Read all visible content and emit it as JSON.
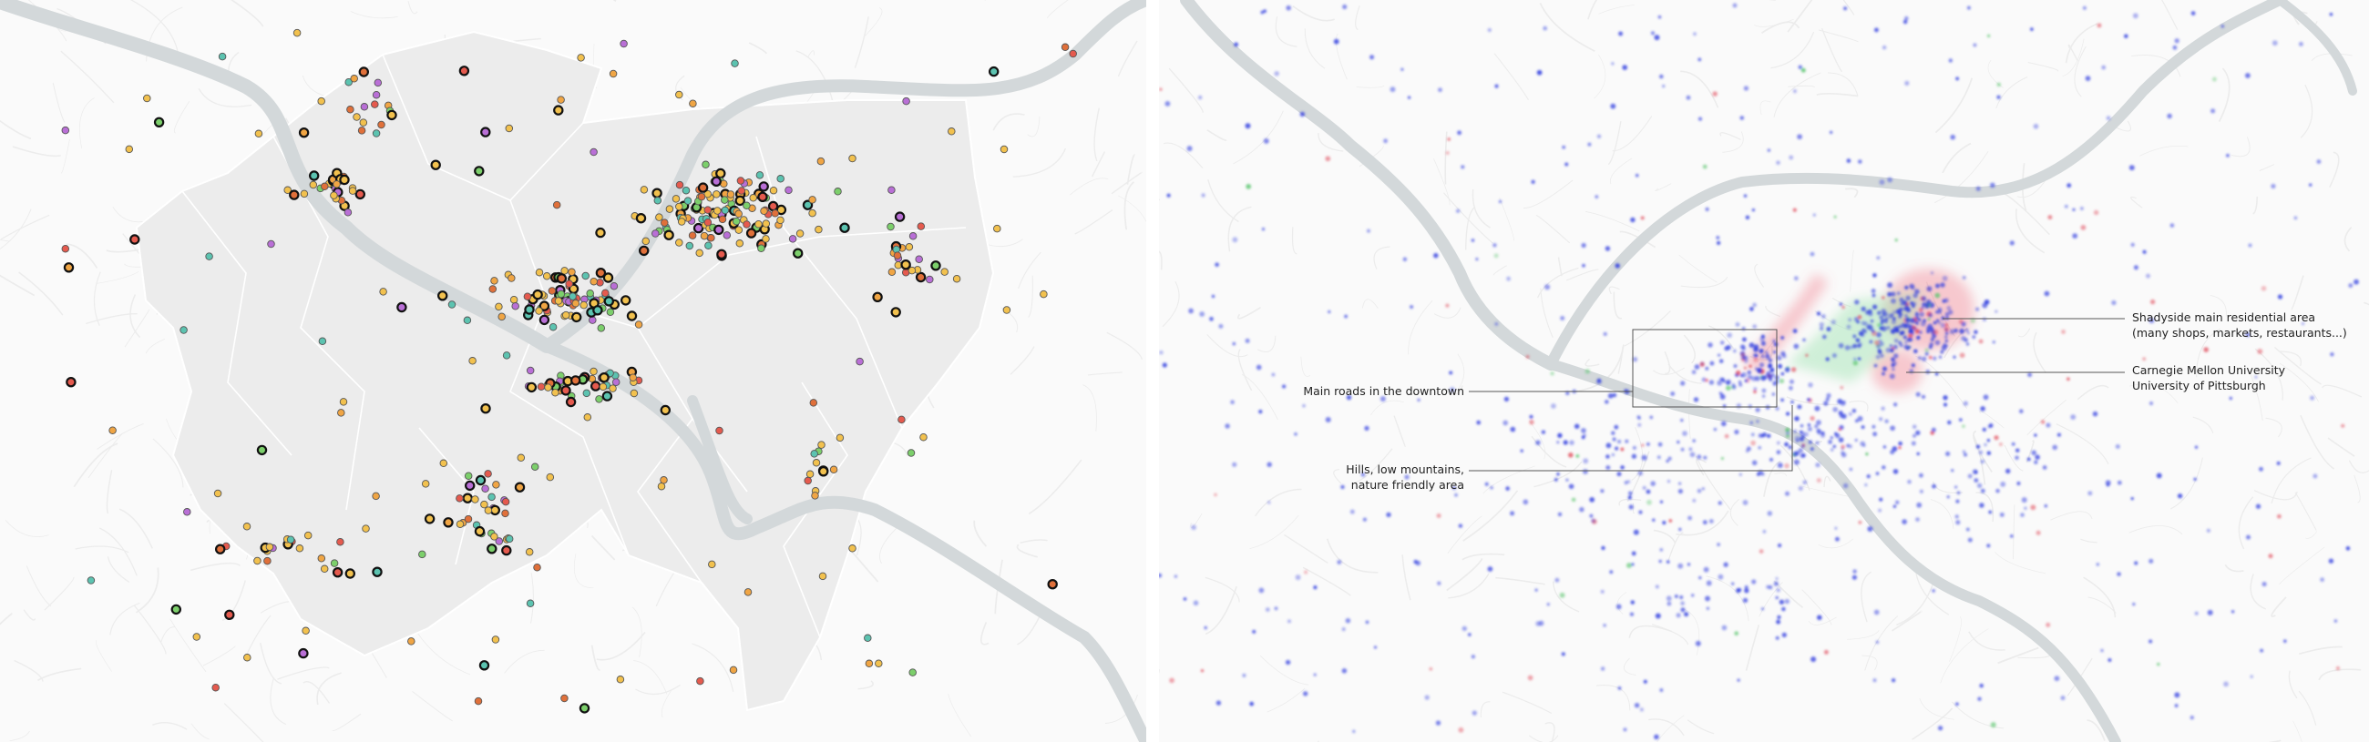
{
  "left_map": {
    "colors": {
      "background": "#fafafa",
      "city_area": "#ececec",
      "city_border": "#ffffff",
      "river": "#d3d8da",
      "road": "#ececec",
      "dot_outline_thick": "#111111",
      "dot_outline_thin": "#555555"
    },
    "dot_palette": [
      "#f2c14e",
      "#f2c14e",
      "#f2c14e",
      "#f2c14e",
      "#f0a544",
      "#e0703a",
      "#7ccf6b",
      "#5cc3b0",
      "#b96fd6",
      "#e55a4e"
    ]
  },
  "right_map": {
    "colors": {
      "background": "#fafafa",
      "river": "#d3d8da",
      "road": "#ececec",
      "point": "#2f3ddf",
      "point_alt_red": "#e04a5a",
      "point_alt_green": "#56c46a",
      "hotspot_red": "#f26a7a",
      "hotspot_green": "#9be3b0",
      "callout_line": "#555555"
    },
    "annotations": [
      {
        "id": "shadyside",
        "lines": [
          "Shadyside main residential area",
          "(many shops, markets, restaurants...)"
        ]
      },
      {
        "id": "universities",
        "lines": [
          "Carnegie Mellon University",
          "University of Pittsburgh"
        ]
      },
      {
        "id": "downtown",
        "lines": [
          "Main roads in the downtown"
        ]
      },
      {
        "id": "hills",
        "lines": [
          "Hills, low mountains,",
          "nature friendly area"
        ]
      }
    ]
  }
}
